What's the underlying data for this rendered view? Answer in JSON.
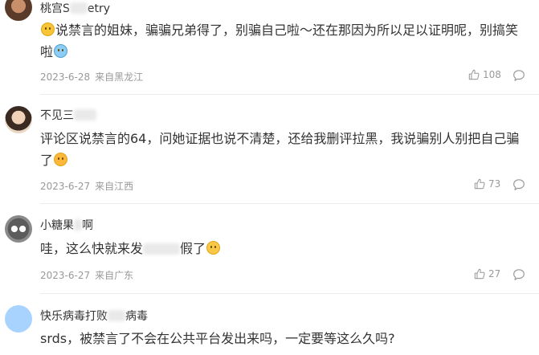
{
  "comments": [
    {
      "username": "桃宫S",
      "username_tail": "etry",
      "text_a": "说禁言的姐妹，骗骗兄弟得了，别骗自己啦～还在那因为所以足以证明呢，别搞笑啦",
      "date": "2023-6-28",
      "location": "来自黑龙江",
      "likes": "108",
      "emoji_lead": "smile-emoji-icon",
      "emoji_tail": "laugh-tears-emoji-icon"
    },
    {
      "username": "不见三",
      "text_a": "评论区说禁言的64，问她证据也说不清楚，还给我删评拉黑，我说骗别人别把自己骗了",
      "date": "2023-6-27",
      "location": "来自江西",
      "likes": "73",
      "emoji_tail": "surprised-emoji-icon"
    },
    {
      "username": "小糖果",
      "username_tail": "啊",
      "text_a": "哇，这么快就来发",
      "text_b": "假了",
      "date": "2023-6-27",
      "location": "来自广东",
      "likes": "27",
      "emoji_tail": "grin-emoji-icon"
    },
    {
      "username": "快乐病毒打败",
      "username_tail": "病毒",
      "text_a": "srds，被禁言了不会在公共平台发出来吗，一定要等这么久吗?"
    }
  ],
  "colors": {
    "text": "#333333",
    "meta": "#999999",
    "divider": "#ececec",
    "avatar_4": "#a9d3ff"
  }
}
